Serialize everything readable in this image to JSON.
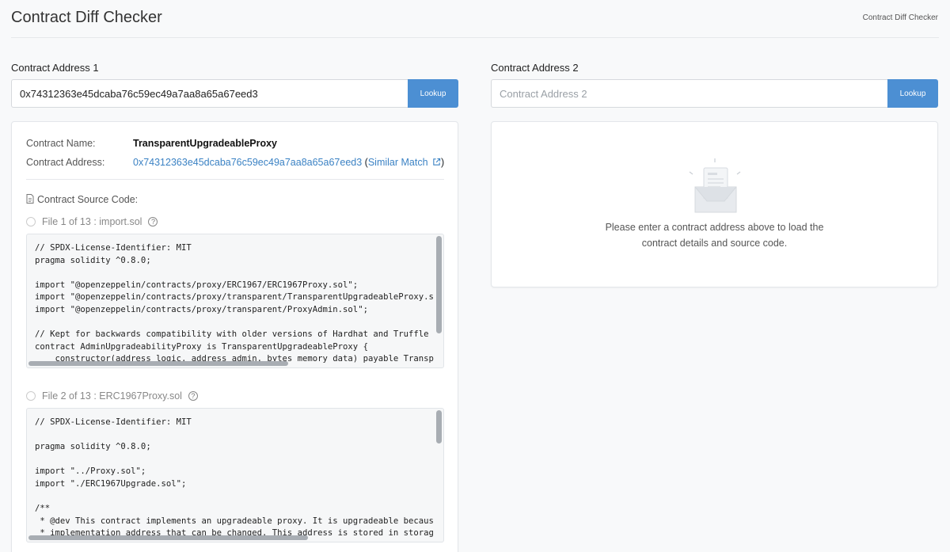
{
  "header": {
    "title": "Contract Diff Checker",
    "breadcrumb": "Contract Diff Checker"
  },
  "left": {
    "label": "Contract Address 1",
    "input_value": "0x74312363e45dcaba76c59ec49a7aa8a65a67eed3",
    "lookup_label": "Lookup",
    "contract_name_key": "Contract Name:",
    "contract_name": "TransparentUpgradeableProxy",
    "contract_address_key": "Contract Address:",
    "contract_address": "0x74312363e45dcaba76c59ec49a7aa8a65a67eed3",
    "similar_open": "(",
    "similar_match": "Similar Match",
    "similar_close": ")",
    "source_title": "Contract Source Code:",
    "files": [
      {
        "label": "File 1 of 13 : import.sol",
        "code": "// SPDX-License-Identifier: MIT\npragma solidity ^0.8.0;\n\nimport \"@openzeppelin/contracts/proxy/ERC1967/ERC1967Proxy.sol\";\nimport \"@openzeppelin/contracts/proxy/transparent/TransparentUpgradeableProxy.sol\";\nimport \"@openzeppelin/contracts/proxy/transparent/ProxyAdmin.sol\";\n\n// Kept for backwards compatibility with older versions of Hardhat and Truffle plugins.\ncontract AdminUpgradeabilityProxy is TransparentUpgradeableProxy {\n    constructor(address logic, address admin, bytes memory data) payable TransparentUpgradeableProxy(logic, admin, data) {}\n}"
      },
      {
        "label": "File 2 of 13 : ERC1967Proxy.sol",
        "code": "// SPDX-License-Identifier: MIT\n\npragma solidity ^0.8.0;\n\nimport \"../Proxy.sol\";\nimport \"./ERC1967Upgrade.sol\";\n\n/**\n * @dev This contract implements an upgradeable proxy. It is upgradeable because calls are delegated to an\n * implementation address that can be changed. This address is stored in storage in the location specified by"
      }
    ]
  },
  "right": {
    "label": "Contract Address 2",
    "placeholder": "Contract Address 2",
    "lookup_label": "Lookup",
    "empty_line1": "Please enter a contract address above to load the",
    "empty_line2": "contract details and source code."
  },
  "colors": {
    "accent": "#4c8fd3",
    "link": "#3b82c4"
  }
}
